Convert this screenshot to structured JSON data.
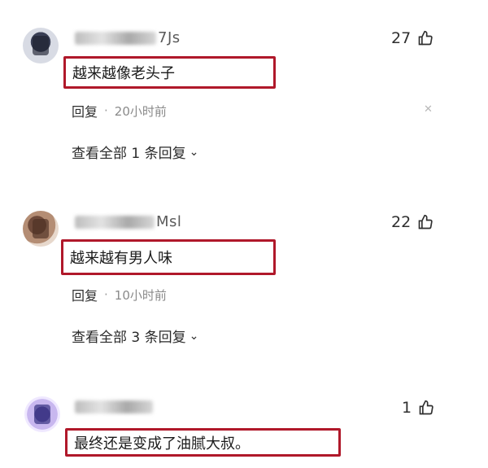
{
  "comments": [
    {
      "username_tail": "7Js",
      "likes": "27",
      "text": "越来越像老头子",
      "reply_label": "回复",
      "time": "20小时前",
      "view_all": "查看全部 1 条回复"
    },
    {
      "username_tail": "Msl",
      "likes": "22",
      "text": "越来越有男人味",
      "reply_label": "回复",
      "time": "10小时前",
      "view_all": "查看全部 3 条回复"
    },
    {
      "username_tail": "",
      "likes": "1",
      "text": "最终还是变成了油腻大叔。",
      "reply_label": "",
      "time": "",
      "view_all": ""
    }
  ],
  "icons": {
    "like": "thumbs-up-icon",
    "close": "close-icon",
    "expand": "chevron-down-icon"
  },
  "colors": {
    "highlight_border": "#b0182a",
    "meta_text": "#8a8a8a"
  }
}
